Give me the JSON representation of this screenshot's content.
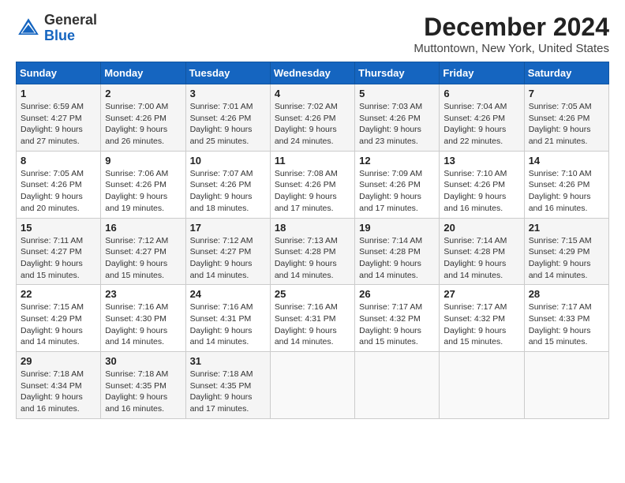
{
  "header": {
    "logo_general": "General",
    "logo_blue": "Blue",
    "title": "December 2024",
    "location": "Muttontown, New York, United States"
  },
  "days_of_week": [
    "Sunday",
    "Monday",
    "Tuesday",
    "Wednesday",
    "Thursday",
    "Friday",
    "Saturday"
  ],
  "weeks": [
    [
      {
        "day": "1",
        "sunrise": "6:59 AM",
        "sunset": "4:27 PM",
        "daylight": "9 hours and 27 minutes."
      },
      {
        "day": "2",
        "sunrise": "7:00 AM",
        "sunset": "4:26 PM",
        "daylight": "9 hours and 26 minutes."
      },
      {
        "day": "3",
        "sunrise": "7:01 AM",
        "sunset": "4:26 PM",
        "daylight": "9 hours and 25 minutes."
      },
      {
        "day": "4",
        "sunrise": "7:02 AM",
        "sunset": "4:26 PM",
        "daylight": "9 hours and 24 minutes."
      },
      {
        "day": "5",
        "sunrise": "7:03 AM",
        "sunset": "4:26 PM",
        "daylight": "9 hours and 23 minutes."
      },
      {
        "day": "6",
        "sunrise": "7:04 AM",
        "sunset": "4:26 PM",
        "daylight": "9 hours and 22 minutes."
      },
      {
        "day": "7",
        "sunrise": "7:05 AM",
        "sunset": "4:26 PM",
        "daylight": "9 hours and 21 minutes."
      }
    ],
    [
      {
        "day": "8",
        "sunrise": "7:05 AM",
        "sunset": "4:26 PM",
        "daylight": "9 hours and 20 minutes."
      },
      {
        "day": "9",
        "sunrise": "7:06 AM",
        "sunset": "4:26 PM",
        "daylight": "9 hours and 19 minutes."
      },
      {
        "day": "10",
        "sunrise": "7:07 AM",
        "sunset": "4:26 PM",
        "daylight": "9 hours and 18 minutes."
      },
      {
        "day": "11",
        "sunrise": "7:08 AM",
        "sunset": "4:26 PM",
        "daylight": "9 hours and 17 minutes."
      },
      {
        "day": "12",
        "sunrise": "7:09 AM",
        "sunset": "4:26 PM",
        "daylight": "9 hours and 17 minutes."
      },
      {
        "day": "13",
        "sunrise": "7:10 AM",
        "sunset": "4:26 PM",
        "daylight": "9 hours and 16 minutes."
      },
      {
        "day": "14",
        "sunrise": "7:10 AM",
        "sunset": "4:26 PM",
        "daylight": "9 hours and 16 minutes."
      }
    ],
    [
      {
        "day": "15",
        "sunrise": "7:11 AM",
        "sunset": "4:27 PM",
        "daylight": "9 hours and 15 minutes."
      },
      {
        "day": "16",
        "sunrise": "7:12 AM",
        "sunset": "4:27 PM",
        "daylight": "9 hours and 15 minutes."
      },
      {
        "day": "17",
        "sunrise": "7:12 AM",
        "sunset": "4:27 PM",
        "daylight": "9 hours and 14 minutes."
      },
      {
        "day": "18",
        "sunrise": "7:13 AM",
        "sunset": "4:28 PM",
        "daylight": "9 hours and 14 minutes."
      },
      {
        "day": "19",
        "sunrise": "7:14 AM",
        "sunset": "4:28 PM",
        "daylight": "9 hours and 14 minutes."
      },
      {
        "day": "20",
        "sunrise": "7:14 AM",
        "sunset": "4:28 PM",
        "daylight": "9 hours and 14 minutes."
      },
      {
        "day": "21",
        "sunrise": "7:15 AM",
        "sunset": "4:29 PM",
        "daylight": "9 hours and 14 minutes."
      }
    ],
    [
      {
        "day": "22",
        "sunrise": "7:15 AM",
        "sunset": "4:29 PM",
        "daylight": "9 hours and 14 minutes."
      },
      {
        "day": "23",
        "sunrise": "7:16 AM",
        "sunset": "4:30 PM",
        "daylight": "9 hours and 14 minutes."
      },
      {
        "day": "24",
        "sunrise": "7:16 AM",
        "sunset": "4:31 PM",
        "daylight": "9 hours and 14 minutes."
      },
      {
        "day": "25",
        "sunrise": "7:16 AM",
        "sunset": "4:31 PM",
        "daylight": "9 hours and 14 minutes."
      },
      {
        "day": "26",
        "sunrise": "7:17 AM",
        "sunset": "4:32 PM",
        "daylight": "9 hours and 15 minutes."
      },
      {
        "day": "27",
        "sunrise": "7:17 AM",
        "sunset": "4:32 PM",
        "daylight": "9 hours and 15 minutes."
      },
      {
        "day": "28",
        "sunrise": "7:17 AM",
        "sunset": "4:33 PM",
        "daylight": "9 hours and 15 minutes."
      }
    ],
    [
      {
        "day": "29",
        "sunrise": "7:18 AM",
        "sunset": "4:34 PM",
        "daylight": "9 hours and 16 minutes."
      },
      {
        "day": "30",
        "sunrise": "7:18 AM",
        "sunset": "4:35 PM",
        "daylight": "9 hours and 16 minutes."
      },
      {
        "day": "31",
        "sunrise": "7:18 AM",
        "sunset": "4:35 PM",
        "daylight": "9 hours and 17 minutes."
      },
      null,
      null,
      null,
      null
    ]
  ],
  "labels": {
    "sunrise": "Sunrise:",
    "sunset": "Sunset:",
    "daylight": "Daylight:"
  }
}
